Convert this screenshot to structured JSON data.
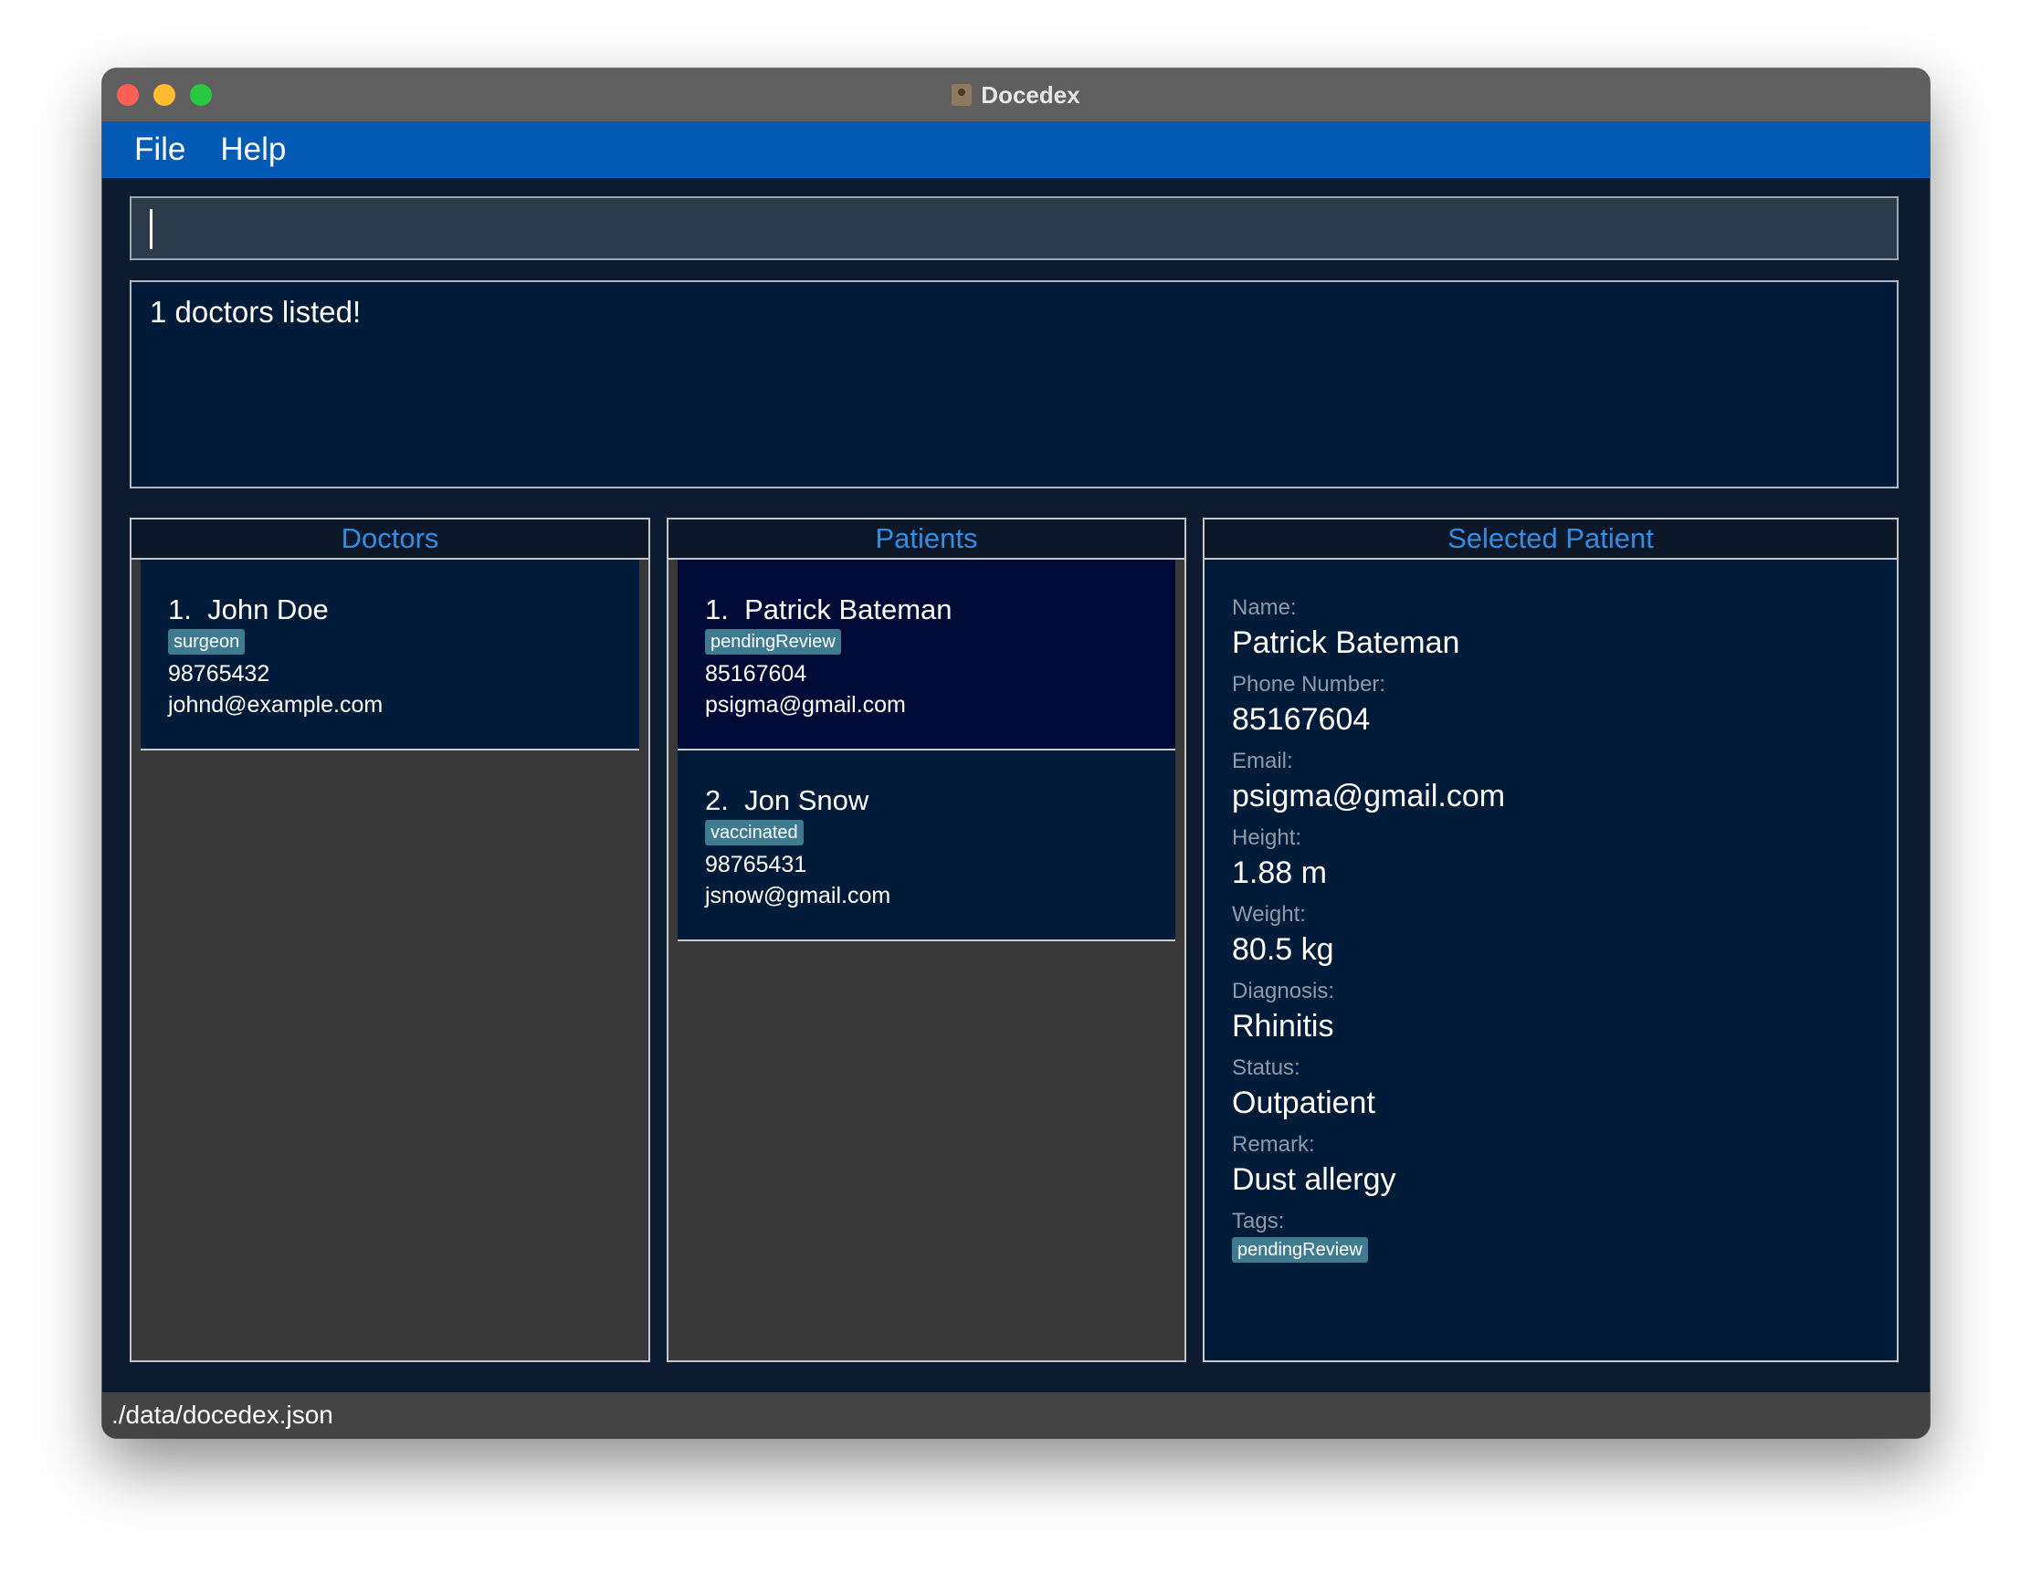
{
  "window": {
    "title": "Docedex"
  },
  "menu": {
    "file": "File",
    "help": "Help"
  },
  "command": {
    "value": ""
  },
  "result": {
    "text": "1 doctors listed!"
  },
  "doctors": {
    "header": "Doctors",
    "items": [
      {
        "index": "1.",
        "name": "John Doe",
        "tag": "surgeon",
        "phone": "98765432",
        "email": "johnd@example.com"
      }
    ]
  },
  "patients": {
    "header": "Patients",
    "items": [
      {
        "index": "1.",
        "name": "Patrick Bateman",
        "tag": "pendingReview",
        "phone": "85167604",
        "email": "psigma@gmail.com"
      },
      {
        "index": "2.",
        "name": "Jon Snow",
        "tag": "vaccinated",
        "phone": "98765431",
        "email": "jsnow@gmail.com"
      }
    ]
  },
  "selected": {
    "header": "Selected Patient",
    "name_label": "Name:",
    "name": "Patrick Bateman",
    "phone_label": "Phone Number:",
    "phone": "85167604",
    "email_label": "Email:",
    "email": "psigma@gmail.com",
    "height_label": "Height:",
    "height": "1.88 m",
    "weight_label": "Weight:",
    "weight": "80.5 kg",
    "diagnosis_label": "Diagnosis:",
    "diagnosis": "Rhinitis",
    "status_label": "Status:",
    "status": "Outpatient",
    "remark_label": "Remark:",
    "remark": "Dust allergy",
    "tags_label": "Tags:",
    "tags": [
      "pendingReview"
    ]
  },
  "statusbar": {
    "path": "./data/docedex.json"
  }
}
